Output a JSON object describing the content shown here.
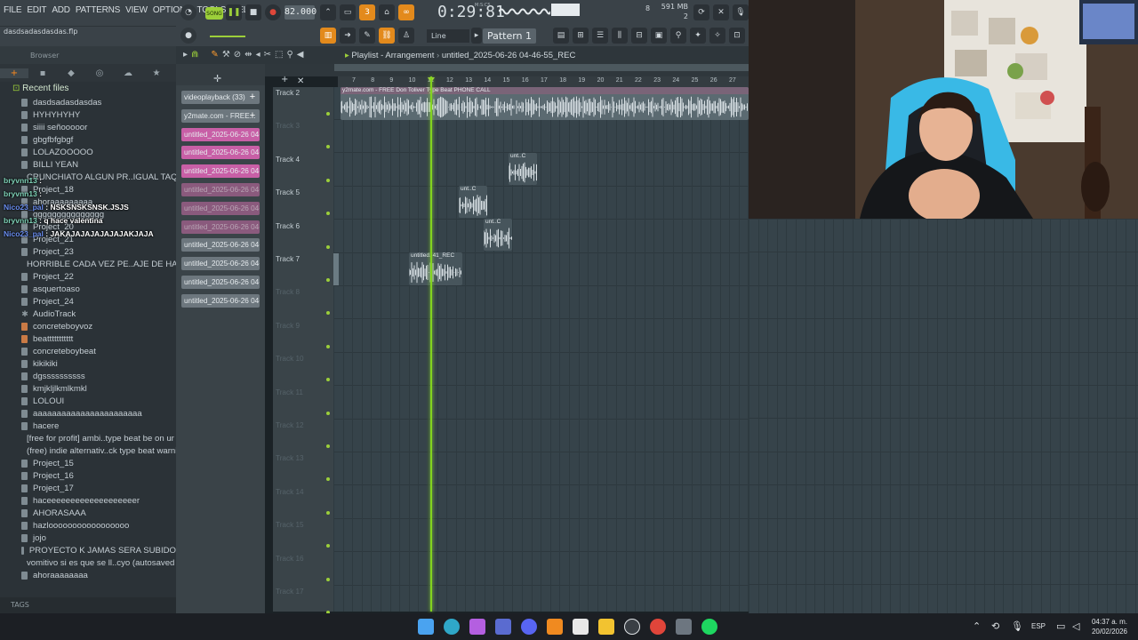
{
  "menu": [
    "FILE",
    "EDIT",
    "ADD",
    "PATTERNS",
    "VIEW",
    "OPTIONS",
    "TOOLS",
    "HELP"
  ],
  "transport": {
    "song_label": "SONG",
    "tempo": "82.000",
    "time": "0:29:81",
    "time_unit": "M:S:CS",
    "memory": "591 MB",
    "cpu_value": "8",
    "voices": "2"
  },
  "project_file": "dasdsadasdasdas.flp",
  "snap": {
    "label": "Line"
  },
  "pattern": {
    "label": "Pattern 1"
  },
  "browser": {
    "title": "Browser",
    "section": "Recent files",
    "items": [
      {
        "label": "dasdsadasdasdas",
        "type": "file"
      },
      {
        "label": "HYHYHYHY",
        "type": "file"
      },
      {
        "label": "siiii señooooor",
        "type": "file"
      },
      {
        "label": "gbgfbfgbgf",
        "type": "file"
      },
      {
        "label": "LOLAZOOOOO",
        "type": "file"
      },
      {
        "label": "BILLI YEAN",
        "type": "file"
      },
      {
        "label": "CRUNCHIATO ALGUN PR..IGUAL TAQ MALITO SI",
        "type": "file"
      },
      {
        "label": "Project_18",
        "type": "file"
      },
      {
        "label": "ahoraaaaaaaaa",
        "type": "file"
      },
      {
        "label": "ggggggggggggggg",
        "type": "file"
      },
      {
        "label": "Project_20",
        "type": "file"
      },
      {
        "label": "Project_21",
        "type": "file"
      },
      {
        "label": "Project_23",
        "type": "file"
      },
      {
        "label": "HORRIBLE CADA VEZ PE..AJE DE HACER MUSICA",
        "type": "file"
      },
      {
        "label": "Project_22",
        "type": "file"
      },
      {
        "label": "asquertoaso",
        "type": "file"
      },
      {
        "label": "Project_24",
        "type": "file"
      },
      {
        "label": "AudioTrack",
        "type": "audio"
      },
      {
        "label": "concreteboyvoz",
        "type": "proj"
      },
      {
        "label": "beattttttttttt",
        "type": "proj"
      },
      {
        "label": "concreteboybeat",
        "type": "file"
      },
      {
        "label": "kikikiki",
        "type": "file"
      },
      {
        "label": "dgssssssssss",
        "type": "file"
      },
      {
        "label": "kmjkljlkmlkmkl",
        "type": "file"
      },
      {
        "label": "LOLOUI",
        "type": "file"
      },
      {
        "label": "aaaaaaaaaaaaaaaaaaaaaaa",
        "type": "file"
      },
      {
        "label": "hacere",
        "type": "file"
      },
      {
        "label": "[free for profit] ambi..type beat be on ur mind",
        "type": "proj"
      },
      {
        "label": "(free) indie  alternativ..ck type beat warning (1)",
        "type": "proj"
      },
      {
        "label": "Project_15",
        "type": "file"
      },
      {
        "label": "Project_16",
        "type": "file"
      },
      {
        "label": "Project_17",
        "type": "file"
      },
      {
        "label": "haceeeeeeeeeeeeeeeeeeer",
        "type": "file"
      },
      {
        "label": "AHORASAAA",
        "type": "file"
      },
      {
        "label": "hazlooooooooooooooooo",
        "type": "file"
      },
      {
        "label": "jojo",
        "type": "file"
      },
      {
        "label": "PROYECTO K JAMAS SERA SUBIDO",
        "type": "file"
      },
      {
        "label": "vomitivo si es que se ll..cyo (autosaved at 2h16)",
        "type": "file"
      },
      {
        "label": "ahoraaaaaaaa",
        "type": "file"
      }
    ],
    "tags_label": "TAGS"
  },
  "chat": [
    {
      "user": "bryvnn13",
      "msg": "",
      "color": "u"
    },
    {
      "user": "bryvnn13",
      "msg": "",
      "color": "u"
    },
    {
      "user": "Nico23_pal",
      "msg": "NSKSNSKSNSK.JSJS",
      "color": "u2"
    },
    {
      "user": "bryvnn13",
      "msg": "q hace valentina",
      "color": "u"
    },
    {
      "user": "Nico23_pal",
      "msg": "JAKAJAJAJAJAJAJAKJAJA",
      "color": "u2"
    }
  ],
  "channels": [
    {
      "label": "videoplayback (33)",
      "style": "g",
      "plus": true
    },
    {
      "label": "y2mate.com - FREE...",
      "style": "g",
      "plus": true
    },
    {
      "label": "untitled_2025-06-26 04-...",
      "style": "p"
    },
    {
      "label": "untitled_2025-06-26 04-...",
      "style": "p"
    },
    {
      "label": "untitled_2025-06-26 04-...",
      "style": "p"
    },
    {
      "label": "untitled_2025-06-26 04-...",
      "style": "pd"
    },
    {
      "label": "untitled_2025-06-26 04-...",
      "style": "pd"
    },
    {
      "label": "untitled_2025-06-26 04-...",
      "style": "pd"
    },
    {
      "label": "untitled_2025-06-26 04-...",
      "style": "g"
    },
    {
      "label": "untitled_2025-06-26 04-...",
      "style": "g"
    },
    {
      "label": "untitled_2025-06-26 04-...",
      "style": "g"
    },
    {
      "label": "untitled_2025-06-26 04-...",
      "style": "g"
    }
  ],
  "playlist": {
    "window": "Playlist - Arrangement",
    "pattern_name": "untitled_2025-06-26 04-46-55_REC",
    "bars": [
      "7",
      "8",
      "9",
      "10",
      "11",
      "12",
      "13",
      "14",
      "15",
      "16",
      "17",
      "18",
      "19",
      "20",
      "21",
      "22",
      "23",
      "24",
      "25",
      "26",
      "27"
    ],
    "tracks": [
      {
        "name": "Track 2",
        "active": true
      },
      {
        "name": "Track 3",
        "active": false
      },
      {
        "name": "Track 4",
        "active": true
      },
      {
        "name": "Track 5",
        "active": true
      },
      {
        "name": "Track 6",
        "active": true
      },
      {
        "name": "Track 7",
        "active": true
      },
      {
        "name": "Track 8",
        "active": false
      },
      {
        "name": "Track 9",
        "active": false
      },
      {
        "name": "Track 10",
        "active": false
      },
      {
        "name": "Track 11",
        "active": false
      },
      {
        "name": "Track 12",
        "active": false
      },
      {
        "name": "Track 13",
        "active": false
      },
      {
        "name": "Track 14",
        "active": false
      },
      {
        "name": "Track 15",
        "active": false
      },
      {
        "name": "Track 16",
        "active": false
      },
      {
        "name": "Track 17",
        "active": false
      }
    ],
    "clips": [
      {
        "label": "y2mate.com - FREE Don Toliver Type Beat  PHONE CALL"
      },
      {
        "label": "unt..C"
      },
      {
        "label": "unt..C"
      },
      {
        "label": "unt..C"
      },
      {
        "label": "untitled..41_REC"
      }
    ]
  },
  "taskbar": {
    "lang": "ESP",
    "time": "04:37 a. m.",
    "date": "20/02/2026"
  }
}
